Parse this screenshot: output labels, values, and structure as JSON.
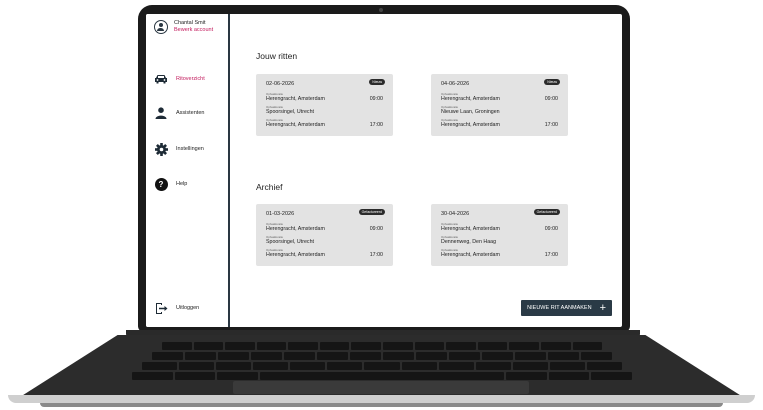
{
  "profile": {
    "name": "Chantal Smit",
    "edit": "Bewerk account"
  },
  "nav": [
    {
      "label": "Ritoverzicht",
      "icon": "car-icon",
      "active": true
    },
    {
      "label": "Assistenten",
      "icon": "person-icon"
    },
    {
      "label": "Instellingen",
      "icon": "gear-icon"
    },
    {
      "label": "Help",
      "icon": "help-icon"
    }
  ],
  "logout": {
    "label": "Uitloggen",
    "icon": "logout-icon"
  },
  "sections": {
    "upcoming": "Jouw ritten",
    "archive": "Archief"
  },
  "rides": [
    {
      "date": "02-06-2026",
      "badge": "Nieuw",
      "stops": [
        {
          "label": "Ophaallocatie",
          "place": "Herengracht, Amsterdam",
          "time": "09:00"
        },
        {
          "label": "Ophaallocatie",
          "place": "Spoorsingel, Utrecht",
          "time": ""
        },
        {
          "label": "Ophaallocatie",
          "place": "Herengracht, Amsterdam",
          "time": "17:00"
        }
      ]
    },
    {
      "date": "04-06-2026",
      "badge": "Nieuw",
      "stops": [
        {
          "label": "Ophaallocatie",
          "place": "Herengracht, Amsterdam",
          "time": "09:00"
        },
        {
          "label": "Ophaallocatie",
          "place": "Nieuwe Laan, Groningen",
          "time": ""
        },
        {
          "label": "Ophaallocatie",
          "place": "Herengracht, Amsterdam",
          "time": "17:00"
        }
      ]
    }
  ],
  "archive": [
    {
      "date": "01-03-2026",
      "badge": "Gefactureerd",
      "stops": [
        {
          "label": "Ophaallocatie",
          "place": "Herengracht, Amsterdam",
          "time": "09:00"
        },
        {
          "label": "Ophaallocatie",
          "place": "Spoorsingel, Utrecht",
          "time": ""
        },
        {
          "label": "Ophaallocatie",
          "place": "Herengracht, Amsterdam",
          "time": "17:00"
        }
      ]
    },
    {
      "date": "30-04-2026",
      "badge": "Gefactureerd",
      "stops": [
        {
          "label": "Ophaallocatie",
          "place": "Herengracht, Amsterdam",
          "time": "09:00"
        },
        {
          "label": "Ophaallocatie",
          "place": "Dennenweg, Den Haag",
          "time": ""
        },
        {
          "label": "Ophaallocatie",
          "place": "Herengracht, Amsterdam",
          "time": "17:00"
        }
      ]
    }
  ],
  "new_ride_button": "NIEUWE RIT AANMAKEN",
  "colors": {
    "accent": "#c2185b",
    "dark": "#2a3a46",
    "card": "#e3e3e3"
  }
}
